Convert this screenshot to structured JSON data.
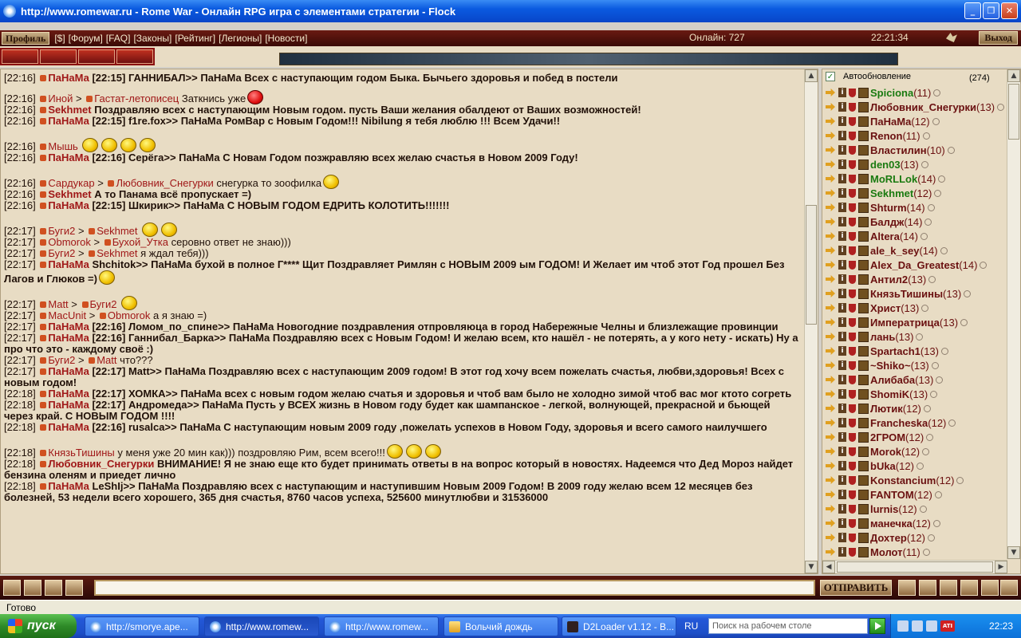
{
  "window": {
    "title": "http://www.romewar.ru - Rome War - Онлайн RPG игра с элементами стратегии - Flock",
    "min": "_",
    "max": "❐",
    "close": "✕"
  },
  "nav": {
    "profile": "Профиль",
    "links": [
      "[$]",
      "[Форум]",
      "[FAQ]",
      "[Законы]",
      "[Рейтинг]",
      "[Легионы]",
      "[Новости]"
    ],
    "online": "Онлайн: 727",
    "clock": "22:21:34",
    "exit": "Выход"
  },
  "chat": {
    "messages": [
      {
        "t": "[22:16]",
        "n": "ПаНаМа",
        "b": true,
        "text": "[22:15] ГАННИБАЛ>> ПаНаМа Всех с  наступающим годом Быка. Бычьего здоровья  и побед в постели"
      },
      {
        "t": "[22:16]",
        "n": "Иной",
        "to": "Гастат-летописец",
        "text": "Заткнись уже",
        "gap": true,
        "smile": "red"
      },
      {
        "t": "[22:16]",
        "n": "Sekhmet",
        "b": true,
        "text": "Поздравляю всех с наступающим Новым  годом. пусть Ваши желания обалдеют от  Ваших возможностей!"
      },
      {
        "t": "[22:16]",
        "n": "ПаНаМа",
        "b": true,
        "text": "[22:15] f1re.fox>> ПаНаМа РомВар  с Новым Годом!!! Nibilung я тебя люблю  !!! Всем Удачи!!"
      },
      {
        "t": "[22:16]",
        "n": "Мышь",
        "text": "",
        "biggap": true,
        "smiles": 4
      },
      {
        "t": "[22:16]",
        "n": "ПаНаМа",
        "b": true,
        "text": "[22:16] Серёга>> ПаНаМа С Новам  Годом позжравляю всех желаю счастья в  Новом 2009 Году!"
      },
      {
        "t": "[22:16]",
        "n": "Сардукар",
        "to": "Любовник_Снегурки",
        "text": "снегурка то зоофилка",
        "biggap": true,
        "smile": "y"
      },
      {
        "t": "[22:16]",
        "n": "Sekhmet",
        "b": true,
        "text": "А то Панама всё пропускает =)"
      },
      {
        "t": "[22:16]",
        "n": "ПаНаМа",
        "b": true,
        "text": "[22:15] Шкирик>> ПаНаМа С НОВЫМ  ГОДОМ ЕДРИТЬ КОЛОТИТЬ!!!!!!!"
      },
      {
        "t": "[22:17]",
        "n": "Буги2",
        "to": "Sekhmet",
        "text": "",
        "biggap": true,
        "smiles": 2
      },
      {
        "t": "[22:17]",
        "n": "Obmorok",
        "to": "Бухой_Утка",
        "text": "серовно ответ не знаю)))"
      },
      {
        "t": "[22:17]",
        "n": "Буги2",
        "to": "Sekhmet",
        "text": "я ждал тебя)))"
      },
      {
        "t": "[22:17]",
        "n": "ПаНаМа",
        "b": true,
        "text": "Shchitok>> ПаНаМа бухой в полное  Г**** Щит Поздравляет Римлян с НОВЫМ  2009 ым ГОДОМ! И Желает им чтоб этот  Год прошел Без Лагов и Глюков =)",
        "smile": "y"
      },
      {
        "t": "[22:17]",
        "n": "Matt",
        "to": "Буги2",
        "text": "",
        "biggap": true,
        "smile": "y"
      },
      {
        "t": "[22:17]",
        "n": "MacUnit",
        "to": "Obmorok",
        "text": "а я знаю =)"
      },
      {
        "t": "[22:17]",
        "n": "ПаНаМа",
        "b": true,
        "text": "[22:16] Ломом_по_спине>> ПаНаМа  Новогодние поздравления отпровляюца в  город Набережные Челны и близлежащие провинции"
      },
      {
        "t": "[22:17]",
        "n": "ПаНаМа",
        "b": true,
        "text": "[22:16] Ганнибал_Барка>> ПаНаМа  Поздравляю всех с Новым Годом! И желаю  всем, кто нашёл - не потерять, а у кого нету - искать) Ну а про что это -  каждому своё :)"
      },
      {
        "t": "[22:17]",
        "n": "Буги2",
        "to": "Matt",
        "text": "что???"
      },
      {
        "t": "[22:17]",
        "n": "ПаНаМа",
        "b": true,
        "text": "[22:17] Matt>> ПаНаМа Поздравляю  всех с наступающим 2009 годом! В этот  год хочу всем пожелать счастья, любви,здоровья! Всех с новым годом!"
      },
      {
        "t": "[22:18]",
        "n": "ПаНаМа",
        "b": true,
        "text": "[22:17] ХОМКА>> ПаНаМа всех с  новым годом желаю счатья и здоровья и  чтоб вам было не холодно зимой чтоб вас  мог ктото согреть"
      },
      {
        "t": "[22:18]",
        "n": "ПаНаМа",
        "b": true,
        "text": "[22:17] Андромеда>> ПаНаМа Пусть  у ВСЕХ жизнь в Новом году будет как  шампанское - легкой, волнующей,  прекрасной и бьющей через край. С НОВЫМ  ГОДОМ !!!!"
      },
      {
        "t": "[22:18]",
        "n": "ПаНаМа",
        "b": true,
        "text": "[22:16] rusalca>> ПаНаМа С  наступающим новым 2009 году ,пожелать  успехов в Новом Году, здоровья и всего  самого наилучшего"
      },
      {
        "t": "[22:18]",
        "n": "КнязьТишины",
        "text": "у меня уже 20 мин как))) поздровляю Рим, всем всего!!!",
        "biggap": true,
        "smiles": 3
      },
      {
        "t": "[22:18]",
        "n": "Любовник_Снегурки",
        "b": true,
        "text": "ВНИМАНИЕ! Я не знаю еще кто будет  принимать ответы в на вопрос который в  новостях. Надеемся что Дед Мороз найдет  бензина оленям и приедет лично"
      },
      {
        "t": "[22:18]",
        "n": "ПаНаМа",
        "b": true,
        "text": "LeShIj>> ПаНаМа Поздравляю всех с  наступающим и наступившим Новым 2009  Годом! В 2009 году желаю всем 12 месяцев без болезней, 53 недели всего  хорошего, 365 дня счастья, 8760 часов  успеха, 525600 минутлюбви и 31536000"
      }
    ],
    "send": "ОТПРАВИТЬ",
    "input_value": ""
  },
  "users": {
    "autoupdate": "Автообновление",
    "count": "(274)",
    "list": [
      {
        "name": "Spiciona",
        "lvl": "(11)",
        "green": true
      },
      {
        "name": "Любовник_Снегурки",
        "lvl": "(13)"
      },
      {
        "name": "ПаНаМа",
        "lvl": "(12)"
      },
      {
        "name": "Renon",
        "lvl": "(11)"
      },
      {
        "name": "Властилин",
        "lvl": "(10)"
      },
      {
        "name": "den03",
        "lvl": "(13)",
        "green": true
      },
      {
        "name": "MoRLLok",
        "lvl": "(14)",
        "green": true
      },
      {
        "name": "Sekhmet",
        "lvl": "(12)",
        "green": true
      },
      {
        "name": "Shturm",
        "lvl": "(14)"
      },
      {
        "name": "Балдж",
        "lvl": "(14)"
      },
      {
        "name": "Altera",
        "lvl": "(14)"
      },
      {
        "name": "ale_k_sey",
        "lvl": "(14)"
      },
      {
        "name": "Alex_Da_Greatest",
        "lvl": "(14)"
      },
      {
        "name": "Антил2",
        "lvl": "(13)"
      },
      {
        "name": "КнязьТишины",
        "lvl": "(13)"
      },
      {
        "name": "Христ",
        "lvl": "(13)"
      },
      {
        "name": "Императрица",
        "lvl": "(13)"
      },
      {
        "name": "лань",
        "lvl": "(13)"
      },
      {
        "name": "Spartach1",
        "lvl": "(13)"
      },
      {
        "name": "~Shiko~",
        "lvl": "(13)"
      },
      {
        "name": "Алибаба",
        "lvl": "(13)"
      },
      {
        "name": "ShomiK",
        "lvl": "(13)"
      },
      {
        "name": "Лютик",
        "lvl": "(12)"
      },
      {
        "name": "Francheska",
        "lvl": "(12)"
      },
      {
        "name": "2ГРОМ",
        "lvl": "(12)"
      },
      {
        "name": "Morok",
        "lvl": "(12)"
      },
      {
        "name": "bUka",
        "lvl": "(12)"
      },
      {
        "name": "Konstancium",
        "lvl": "(12)"
      },
      {
        "name": "FANTOM",
        "lvl": "(12)"
      },
      {
        "name": "lurnis",
        "lvl": "(12)"
      },
      {
        "name": "манечка",
        "lvl": "(12)"
      },
      {
        "name": "Дохтер",
        "lvl": "(12)"
      },
      {
        "name": "Молот",
        "lvl": "(11)"
      }
    ]
  },
  "status": "Готово",
  "taskbar": {
    "start": "пуск",
    "tasks": [
      {
        "label": "http://smorye.ape...",
        "icon": "browser"
      },
      {
        "label": "http://www.romew...",
        "icon": "browser",
        "active": true
      },
      {
        "label": "http://www.romew...",
        "icon": "browser"
      },
      {
        "label": "Вольчий дождь",
        "icon": "folder"
      },
      {
        "label": "D2Loader v1.12 - B...",
        "icon": "game"
      }
    ],
    "lang": "RU",
    "search_placeholder": "Поиск на рабочем столе",
    "time": "22:23"
  }
}
